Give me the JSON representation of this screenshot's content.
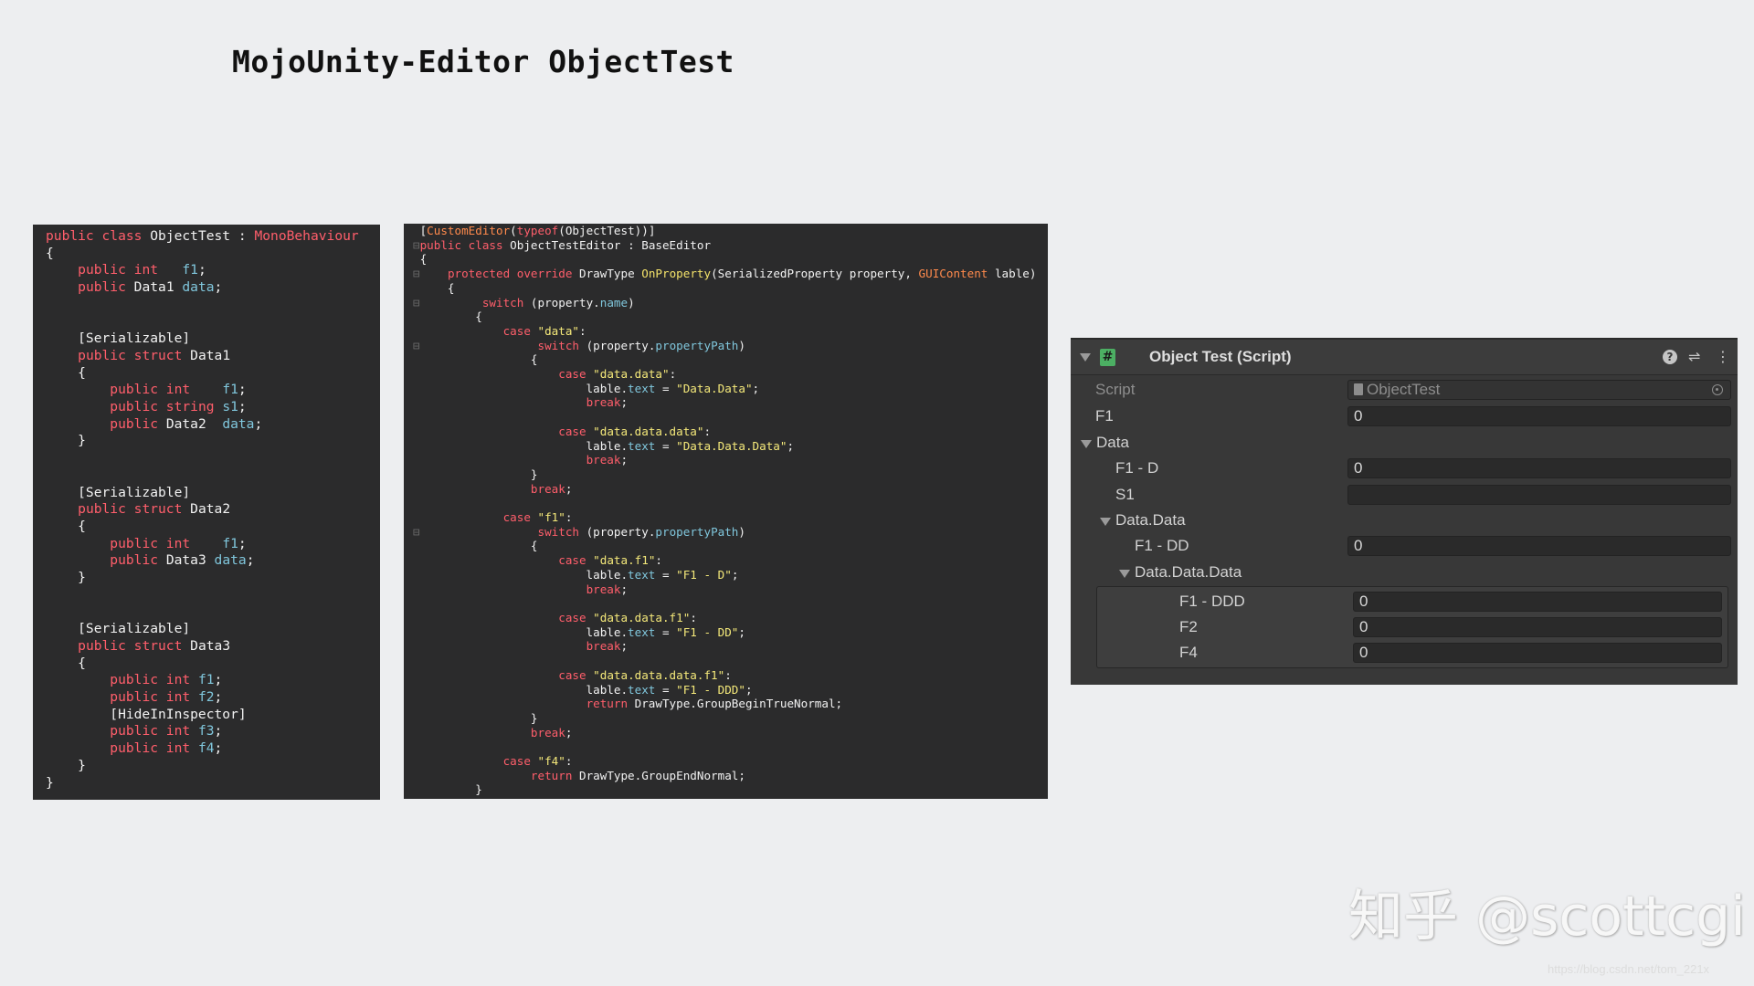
{
  "title": "MojoUnity-Editor ObjectTest",
  "code_left": [
    [
      [
        "kw",
        "public class "
      ],
      [
        "tx",
        "ObjectTest : "
      ],
      [
        "kw",
        "MonoBehaviour"
      ]
    ],
    [
      [
        "tx",
        "{"
      ]
    ],
    [
      [
        "tx",
        "    "
      ],
      [
        "kw",
        "public int"
      ],
      [
        "tx",
        "   "
      ],
      [
        "vr",
        "f1"
      ],
      [
        "tx",
        ";"
      ]
    ],
    [
      [
        "tx",
        "    "
      ],
      [
        "kw",
        "public "
      ],
      [
        "tx",
        "Data1 "
      ],
      [
        "vr",
        "data"
      ],
      [
        "tx",
        ";"
      ]
    ],
    [],
    [],
    [
      [
        "tx",
        "    [Serializable]"
      ]
    ],
    [
      [
        "tx",
        "    "
      ],
      [
        "kw",
        "public struct "
      ],
      [
        "tx",
        "Data1"
      ]
    ],
    [
      [
        "tx",
        "    {"
      ]
    ],
    [
      [
        "tx",
        "        "
      ],
      [
        "kw",
        "public int"
      ],
      [
        "tx",
        "    "
      ],
      [
        "vr",
        "f1"
      ],
      [
        "tx",
        ";"
      ]
    ],
    [
      [
        "tx",
        "        "
      ],
      [
        "kw",
        "public string "
      ],
      [
        "vr",
        "s1"
      ],
      [
        "tx",
        ";"
      ]
    ],
    [
      [
        "tx",
        "        "
      ],
      [
        "kw",
        "public "
      ],
      [
        "tx",
        "Data2  "
      ],
      [
        "vr",
        "data"
      ],
      [
        "tx",
        ";"
      ]
    ],
    [
      [
        "tx",
        "    }"
      ]
    ],
    [],
    [],
    [
      [
        "tx",
        "    [Serializable]"
      ]
    ],
    [
      [
        "tx",
        "    "
      ],
      [
        "kw",
        "public struct "
      ],
      [
        "tx",
        "Data2"
      ]
    ],
    [
      [
        "tx",
        "    {"
      ]
    ],
    [
      [
        "tx",
        "        "
      ],
      [
        "kw",
        "public int"
      ],
      [
        "tx",
        "    "
      ],
      [
        "vr",
        "f1"
      ],
      [
        "tx",
        ";"
      ]
    ],
    [
      [
        "tx",
        "        "
      ],
      [
        "kw",
        "public "
      ],
      [
        "tx",
        "Data3 "
      ],
      [
        "vr",
        "data"
      ],
      [
        "tx",
        ";"
      ]
    ],
    [
      [
        "tx",
        "    }"
      ]
    ],
    [],
    [],
    [
      [
        "tx",
        "    [Serializable]"
      ]
    ],
    [
      [
        "tx",
        "    "
      ],
      [
        "kw",
        "public struct "
      ],
      [
        "tx",
        "Data3"
      ]
    ],
    [
      [
        "tx",
        "    {"
      ]
    ],
    [
      [
        "tx",
        "        "
      ],
      [
        "kw",
        "public int "
      ],
      [
        "vr",
        "f1"
      ],
      [
        "tx",
        ";"
      ]
    ],
    [
      [
        "tx",
        "        "
      ],
      [
        "kw",
        "public int "
      ],
      [
        "vr",
        "f2"
      ],
      [
        "tx",
        ";"
      ]
    ],
    [
      [
        "tx",
        "        [HideInInspector]"
      ]
    ],
    [
      [
        "tx",
        "        "
      ],
      [
        "kw",
        "public int "
      ],
      [
        "vr",
        "f3"
      ],
      [
        "tx",
        ";"
      ]
    ],
    [
      [
        "tx",
        "        "
      ],
      [
        "kw",
        "public int "
      ],
      [
        "vr",
        "f4"
      ],
      [
        "tx",
        ";"
      ]
    ],
    [
      [
        "tx",
        "    }"
      ]
    ],
    [
      [
        "tx",
        "}"
      ]
    ]
  ],
  "code_right": [
    [
      [
        "tx",
        " ["
      ],
      [
        "ty",
        "CustomEditor"
      ],
      [
        "tx",
        "("
      ],
      [
        "kw",
        "typeof"
      ],
      [
        "tx",
        "(ObjectTest))]"
      ]
    ],
    [
      [
        "gt",
        "⊟"
      ],
      [
        "kw",
        "public class "
      ],
      [
        "tx",
        "ObjectTestEditor : BaseEditor"
      ]
    ],
    [
      [
        "tx",
        " {"
      ]
    ],
    [
      [
        "gt",
        "⊟"
      ],
      [
        "tx",
        "    "
      ],
      [
        "kw",
        "protected override "
      ],
      [
        "tx",
        "DrawType "
      ],
      [
        "fn",
        "OnProperty"
      ],
      [
        "tx",
        "(SerializedProperty property, "
      ],
      [
        "ty",
        "GUIContent"
      ],
      [
        "tx",
        " lable)"
      ]
    ],
    [
      [
        "tx",
        "     {"
      ]
    ],
    [
      [
        "gt",
        "⊟"
      ],
      [
        "tx",
        "         "
      ],
      [
        "kw",
        "switch"
      ],
      [
        "tx",
        " (property."
      ],
      [
        "vr",
        "name"
      ],
      [
        "tx",
        ")"
      ]
    ],
    [
      [
        "tx",
        "         {"
      ]
    ],
    [
      [
        "tx",
        "             "
      ],
      [
        "kw",
        "case "
      ],
      [
        "st",
        "\"data\""
      ],
      [
        "tx",
        ":"
      ]
    ],
    [
      [
        "gt",
        "⊟"
      ],
      [
        "tx",
        "                 "
      ],
      [
        "kw",
        "switch"
      ],
      [
        "tx",
        " (property."
      ],
      [
        "vr",
        "propertyPath"
      ],
      [
        "tx",
        ")"
      ]
    ],
    [
      [
        "tx",
        "                 {"
      ]
    ],
    [
      [
        "tx",
        "                     "
      ],
      [
        "kw",
        "case "
      ],
      [
        "st",
        "\"data.data\""
      ],
      [
        "tx",
        ":"
      ]
    ],
    [
      [
        "tx",
        "                         lable."
      ],
      [
        "vr",
        "text"
      ],
      [
        "tx",
        " = "
      ],
      [
        "st",
        "\"Data.Data\""
      ],
      [
        "tx",
        ";"
      ]
    ],
    [
      [
        "tx",
        "                         "
      ],
      [
        "kw",
        "break"
      ],
      [
        "tx",
        ";"
      ]
    ],
    [],
    [
      [
        "tx",
        "                     "
      ],
      [
        "kw",
        "case "
      ],
      [
        "st",
        "\"data.data.data\""
      ],
      [
        "tx",
        ":"
      ]
    ],
    [
      [
        "tx",
        "                         lable."
      ],
      [
        "vr",
        "text"
      ],
      [
        "tx",
        " = "
      ],
      [
        "st",
        "\"Data.Data.Data\""
      ],
      [
        "tx",
        ";"
      ]
    ],
    [
      [
        "tx",
        "                         "
      ],
      [
        "kw",
        "break"
      ],
      [
        "tx",
        ";"
      ]
    ],
    [
      [
        "tx",
        "                 }"
      ]
    ],
    [
      [
        "tx",
        "                 "
      ],
      [
        "kw",
        "break"
      ],
      [
        "tx",
        ";"
      ]
    ],
    [],
    [
      [
        "tx",
        "             "
      ],
      [
        "kw",
        "case "
      ],
      [
        "st",
        "\"f1\""
      ],
      [
        "tx",
        ":"
      ]
    ],
    [
      [
        "gt",
        "⊟"
      ],
      [
        "tx",
        "                 "
      ],
      [
        "kw",
        "switch"
      ],
      [
        "tx",
        " (property."
      ],
      [
        "vr",
        "propertyPath"
      ],
      [
        "tx",
        ")"
      ]
    ],
    [
      [
        "tx",
        "                 {"
      ]
    ],
    [
      [
        "tx",
        "                     "
      ],
      [
        "kw",
        "case "
      ],
      [
        "st",
        "\"data.f1\""
      ],
      [
        "tx",
        ":"
      ]
    ],
    [
      [
        "tx",
        "                         lable."
      ],
      [
        "vr",
        "text"
      ],
      [
        "tx",
        " = "
      ],
      [
        "st",
        "\"F1 - D\""
      ],
      [
        "tx",
        ";"
      ]
    ],
    [
      [
        "tx",
        "                         "
      ],
      [
        "kw",
        "break"
      ],
      [
        "tx",
        ";"
      ]
    ],
    [],
    [
      [
        "tx",
        "                     "
      ],
      [
        "kw",
        "case "
      ],
      [
        "st",
        "\"data.data.f1\""
      ],
      [
        "tx",
        ":"
      ]
    ],
    [
      [
        "tx",
        "                         lable."
      ],
      [
        "vr",
        "text"
      ],
      [
        "tx",
        " = "
      ],
      [
        "st",
        "\"F1 - DD\""
      ],
      [
        "tx",
        ";"
      ]
    ],
    [
      [
        "tx",
        "                         "
      ],
      [
        "kw",
        "break"
      ],
      [
        "tx",
        ";"
      ]
    ],
    [],
    [
      [
        "tx",
        "                     "
      ],
      [
        "kw",
        "case "
      ],
      [
        "st",
        "\"data.data.data.f1\""
      ],
      [
        "tx",
        ":"
      ]
    ],
    [
      [
        "tx",
        "                         lable."
      ],
      [
        "vr",
        "text"
      ],
      [
        "tx",
        " = "
      ],
      [
        "st",
        "\"F1 - DDD\""
      ],
      [
        "tx",
        ";"
      ]
    ],
    [
      [
        "tx",
        "                         "
      ],
      [
        "kw",
        "return "
      ],
      [
        "tx",
        "DrawType.GroupBeginTrueNormal;"
      ]
    ],
    [
      [
        "tx",
        "                 }"
      ]
    ],
    [
      [
        "tx",
        "                 "
      ],
      [
        "kw",
        "break"
      ],
      [
        "tx",
        ";"
      ]
    ],
    [],
    [
      [
        "tx",
        "             "
      ],
      [
        "kw",
        "case "
      ],
      [
        "st",
        "\"f4\""
      ],
      [
        "tx",
        ":"
      ]
    ],
    [
      [
        "tx",
        "                 "
      ],
      [
        "kw",
        "return "
      ],
      [
        "tx",
        "DrawType.GroupEndNormal;"
      ]
    ],
    [
      [
        "tx",
        "         }"
      ]
    ]
  ],
  "inspector": {
    "title": "Object Test (Script)",
    "script_icon": "#",
    "header_icons": [
      "help-icon",
      "preset-icon",
      "menu-icon"
    ],
    "rows": {
      "script_label": "Script",
      "script_value": "ObjectTest",
      "f1_label": "F1",
      "f1_value": "0",
      "data_label": "Data",
      "f1d_label": "F1 - D",
      "f1d_value": "0",
      "s1_label": "S1",
      "s1_value": "",
      "datadata_label": "Data.Data",
      "f1dd_label": "F1 - DD",
      "f1dd_value": "0",
      "datadatadata_label": "Data.Data.Data",
      "f1ddd_label": "F1 - DDD",
      "f1ddd_value": "0",
      "f2_label": "F2",
      "f2_value": "0",
      "f4_label": "F4",
      "f4_value": "0"
    }
  },
  "watermark": "知乎 @scottcgi",
  "url_watermark": "https://blog.csdn.net/tom_221x",
  "colors": {
    "background": "#edeef0",
    "code_bg": "#2b2b2c",
    "keyword": "#ff5e6b",
    "variable": "#80c7dd",
    "string": "#f5e97a",
    "inspector_bg": "#383838"
  }
}
